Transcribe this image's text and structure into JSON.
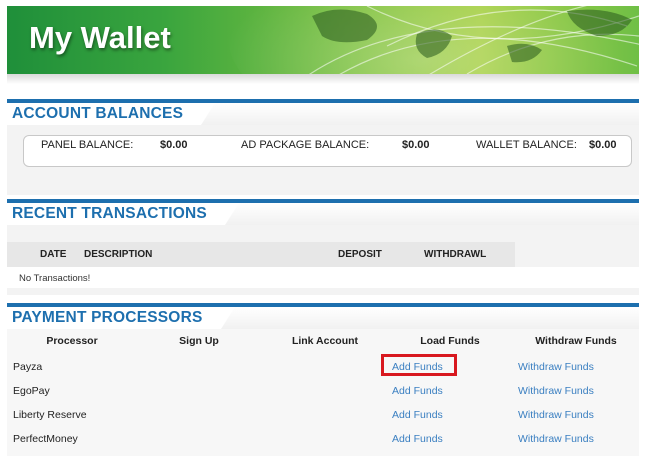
{
  "header": {
    "title": "My Wallet"
  },
  "account_balances": {
    "heading": "ACCOUNT BALANCES",
    "panel_label": "PANEL BALANCE:",
    "panel_value": "$0.00",
    "ad_label": "AD PACKAGE BALANCE:",
    "ad_value": "$0.00",
    "wallet_label": "WALLET BALANCE:",
    "wallet_value": "$0.00"
  },
  "recent_transactions": {
    "heading": "RECENT TRANSACTIONS",
    "columns": [
      "DATE",
      "DESCRIPTION",
      "DEPOSIT",
      "WITHDRAWL"
    ],
    "empty_message": "No Transactions!"
  },
  "payment_processors": {
    "heading": "PAYMENT PROCESSORS",
    "columns": [
      "Processor",
      "Sign Up",
      "Link Account",
      "Load Funds",
      "Withdraw Funds"
    ],
    "rows": [
      {
        "name": "Payza",
        "add": "Add Funds",
        "withdraw": "Withdraw Funds"
      },
      {
        "name": "EgoPay",
        "add": "Add Funds",
        "withdraw": "Withdraw Funds"
      },
      {
        "name": "Liberty Reserve",
        "add": "Add Funds",
        "withdraw": "Withdraw Funds"
      },
      {
        "name": "PerfectMoney",
        "add": "Add Funds",
        "withdraw": "Withdraw Funds"
      }
    ]
  },
  "colors": {
    "accent_blue": "#1d6fae",
    "link_blue": "#3a7fc1",
    "highlight_red": "#d8181f",
    "banner_green": "#3aa53e"
  }
}
